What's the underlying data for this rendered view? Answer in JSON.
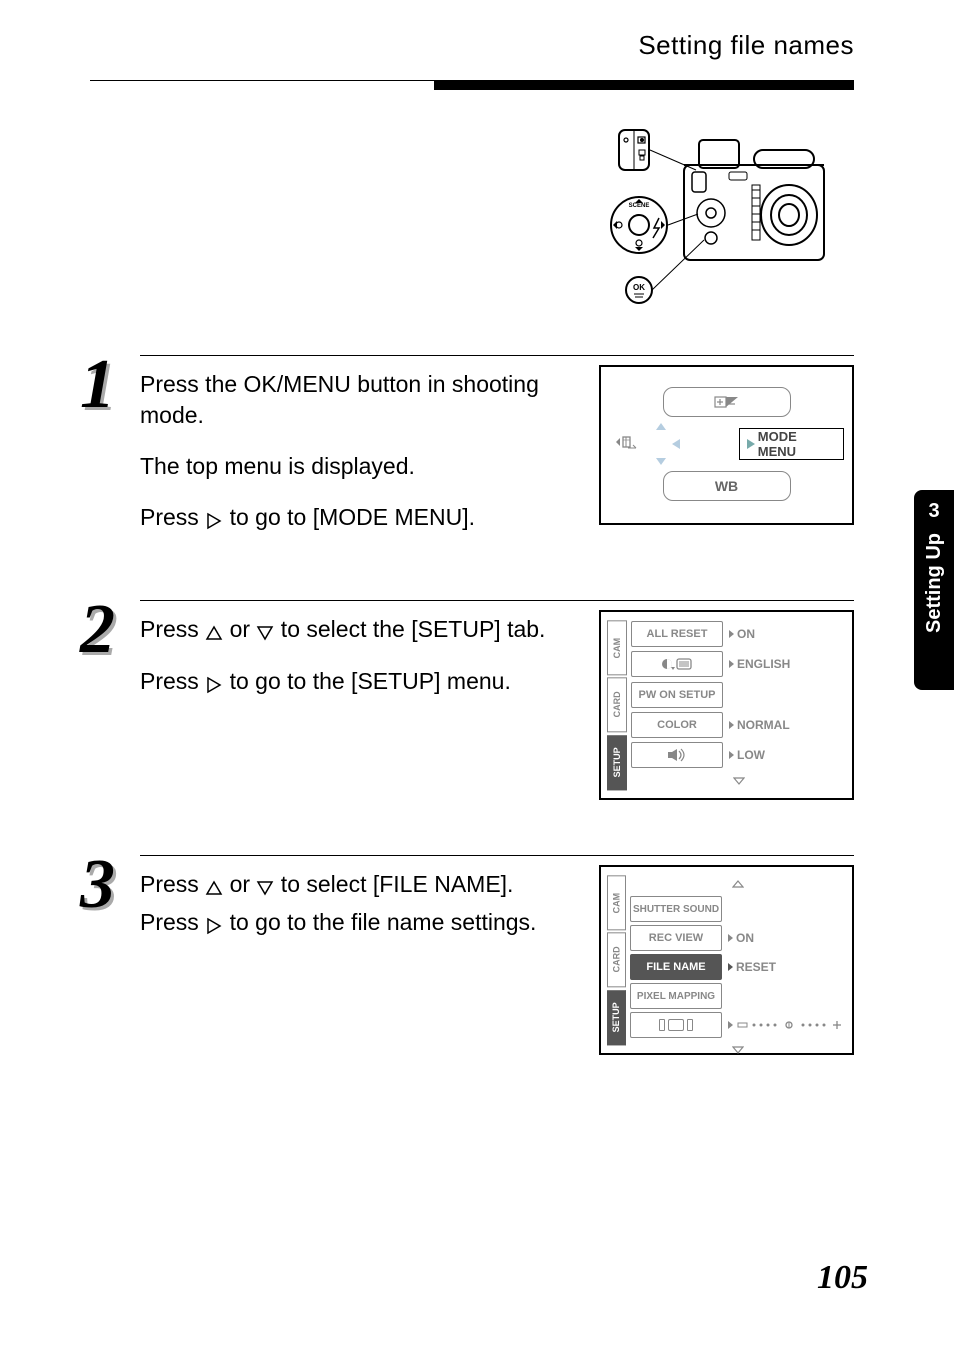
{
  "page": {
    "title": "Setting file names",
    "number": "105"
  },
  "side_tab": {
    "chapter_num": "3",
    "chapter_label": "Setting Up"
  },
  "steps": {
    "s1": {
      "num": "1",
      "line1": "Press the OK/MENU button in shooting mode.",
      "line2": "The top menu is displayed.",
      "line3a": "Press ",
      "line3b": " to go to [MODE MENU]."
    },
    "s2": {
      "num": "2",
      "line1a": "Press ",
      "line1b": " or ",
      "line1c": " to select the [SETUP] tab.",
      "line2a": "Press ",
      "line2b": " to go to the [SETUP] menu."
    },
    "s3": {
      "num": "3",
      "line1a": "Press ",
      "line1b": " or ",
      "line1c": " to select [FILE NAME].",
      "line2a": "Press ",
      "line2b": " to go to the file name settings."
    }
  },
  "screen1": {
    "wb": "WB",
    "mode_menu": "MODE MENU"
  },
  "screen2": {
    "tabs": {
      "cam": "CAM",
      "card": "CARD",
      "setup": "SETUP"
    },
    "rows": {
      "all_reset": "ALL RESET",
      "all_reset_val": "ON",
      "lang_val": "ENGLISH",
      "pw_on": "PW ON SETUP",
      "color": "COLOR",
      "color_val": "NORMAL",
      "beep_val": "LOW"
    }
  },
  "screen3": {
    "tabs": {
      "cam": "CAM",
      "card": "CARD",
      "setup": "SETUP"
    },
    "rows": {
      "shutter": "SHUTTER SOUND",
      "recview": "REC VIEW",
      "recview_val": "ON",
      "filename": "FILE NAME",
      "filename_val": "RESET",
      "pixel": "PIXEL MAPPING"
    }
  }
}
